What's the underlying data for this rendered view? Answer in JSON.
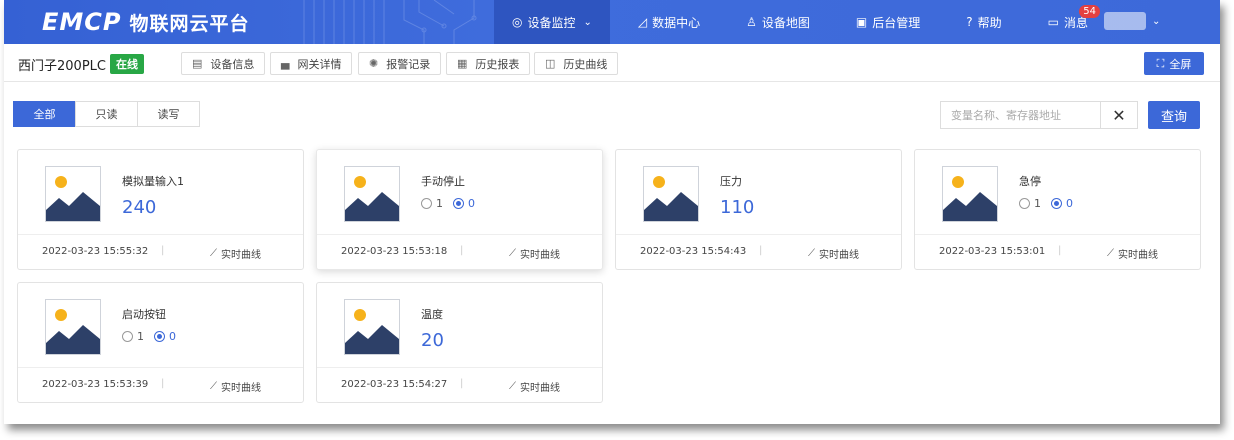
{
  "logo": {
    "mark": "EMCP",
    "name": "物联网云平台"
  },
  "nav": [
    {
      "label": "设备监控",
      "icon": "location-icon",
      "glyph": "◎",
      "active": true,
      "caret": true
    },
    {
      "label": "数据中心",
      "icon": "chart-icon",
      "glyph": "◿",
      "active": false
    },
    {
      "label": "设备地图",
      "icon": "person-pin-icon",
      "glyph": "♙",
      "active": false
    },
    {
      "label": "后台管理",
      "icon": "monitor-icon",
      "glyph": "▣",
      "active": false
    },
    {
      "label": "帮助",
      "icon": "help-icon",
      "glyph": "?",
      "active": false
    },
    {
      "label": "消息",
      "icon": "message-icon",
      "glyph": "▭",
      "active": false,
      "badge": "54"
    }
  ],
  "device": {
    "name": "西门子200PLC",
    "status": "在线"
  },
  "sub_buttons": [
    {
      "label": "设备信息",
      "glyph": "▤",
      "icon": "info-card-icon"
    },
    {
      "label": "网关详情",
      "glyph": "▄",
      "icon": "gateway-icon"
    },
    {
      "label": "报警记录",
      "glyph": "✺",
      "icon": "alarm-icon"
    },
    {
      "label": "历史报表",
      "glyph": "▦",
      "icon": "report-icon"
    },
    {
      "label": "历史曲线",
      "glyph": "◫",
      "icon": "curve-icon"
    }
  ],
  "fullscreen_label": "全屏",
  "filters": {
    "tabs": [
      "全部",
      "只读",
      "读写"
    ],
    "active": 0
  },
  "search": {
    "placeholder": "变量名称、寄存器地址",
    "value": "",
    "clear": "✕",
    "query_label": "查询"
  },
  "curve_label": "实时曲线",
  "cards": [
    {
      "label": "模拟量输入1",
      "type": "value",
      "value": "240",
      "time": "2022-03-23 15:55:32"
    },
    {
      "label": "手动停止",
      "type": "switch",
      "options": [
        "1",
        "0"
      ],
      "selected": 1,
      "time": "2022-03-23 15:53:18"
    },
    {
      "label": "压力",
      "type": "value",
      "value": "110",
      "time": "2022-03-23 15:54:43"
    },
    {
      "label": "急停",
      "type": "switch",
      "options": [
        "1",
        "0"
      ],
      "selected": 1,
      "time": "2022-03-23 15:53:01"
    },
    {
      "label": "启动按钮",
      "type": "switch",
      "options": [
        "1",
        "0"
      ],
      "selected": 1,
      "time": "2022-03-23 15:53:39"
    },
    {
      "label": "温度",
      "type": "value",
      "value": "20",
      "time": "2022-03-23 15:54:27"
    }
  ],
  "colors": {
    "primary": "#3c68d8",
    "online": "#28a745",
    "sun": "#f6b21b",
    "mountain": "#2d4068"
  }
}
